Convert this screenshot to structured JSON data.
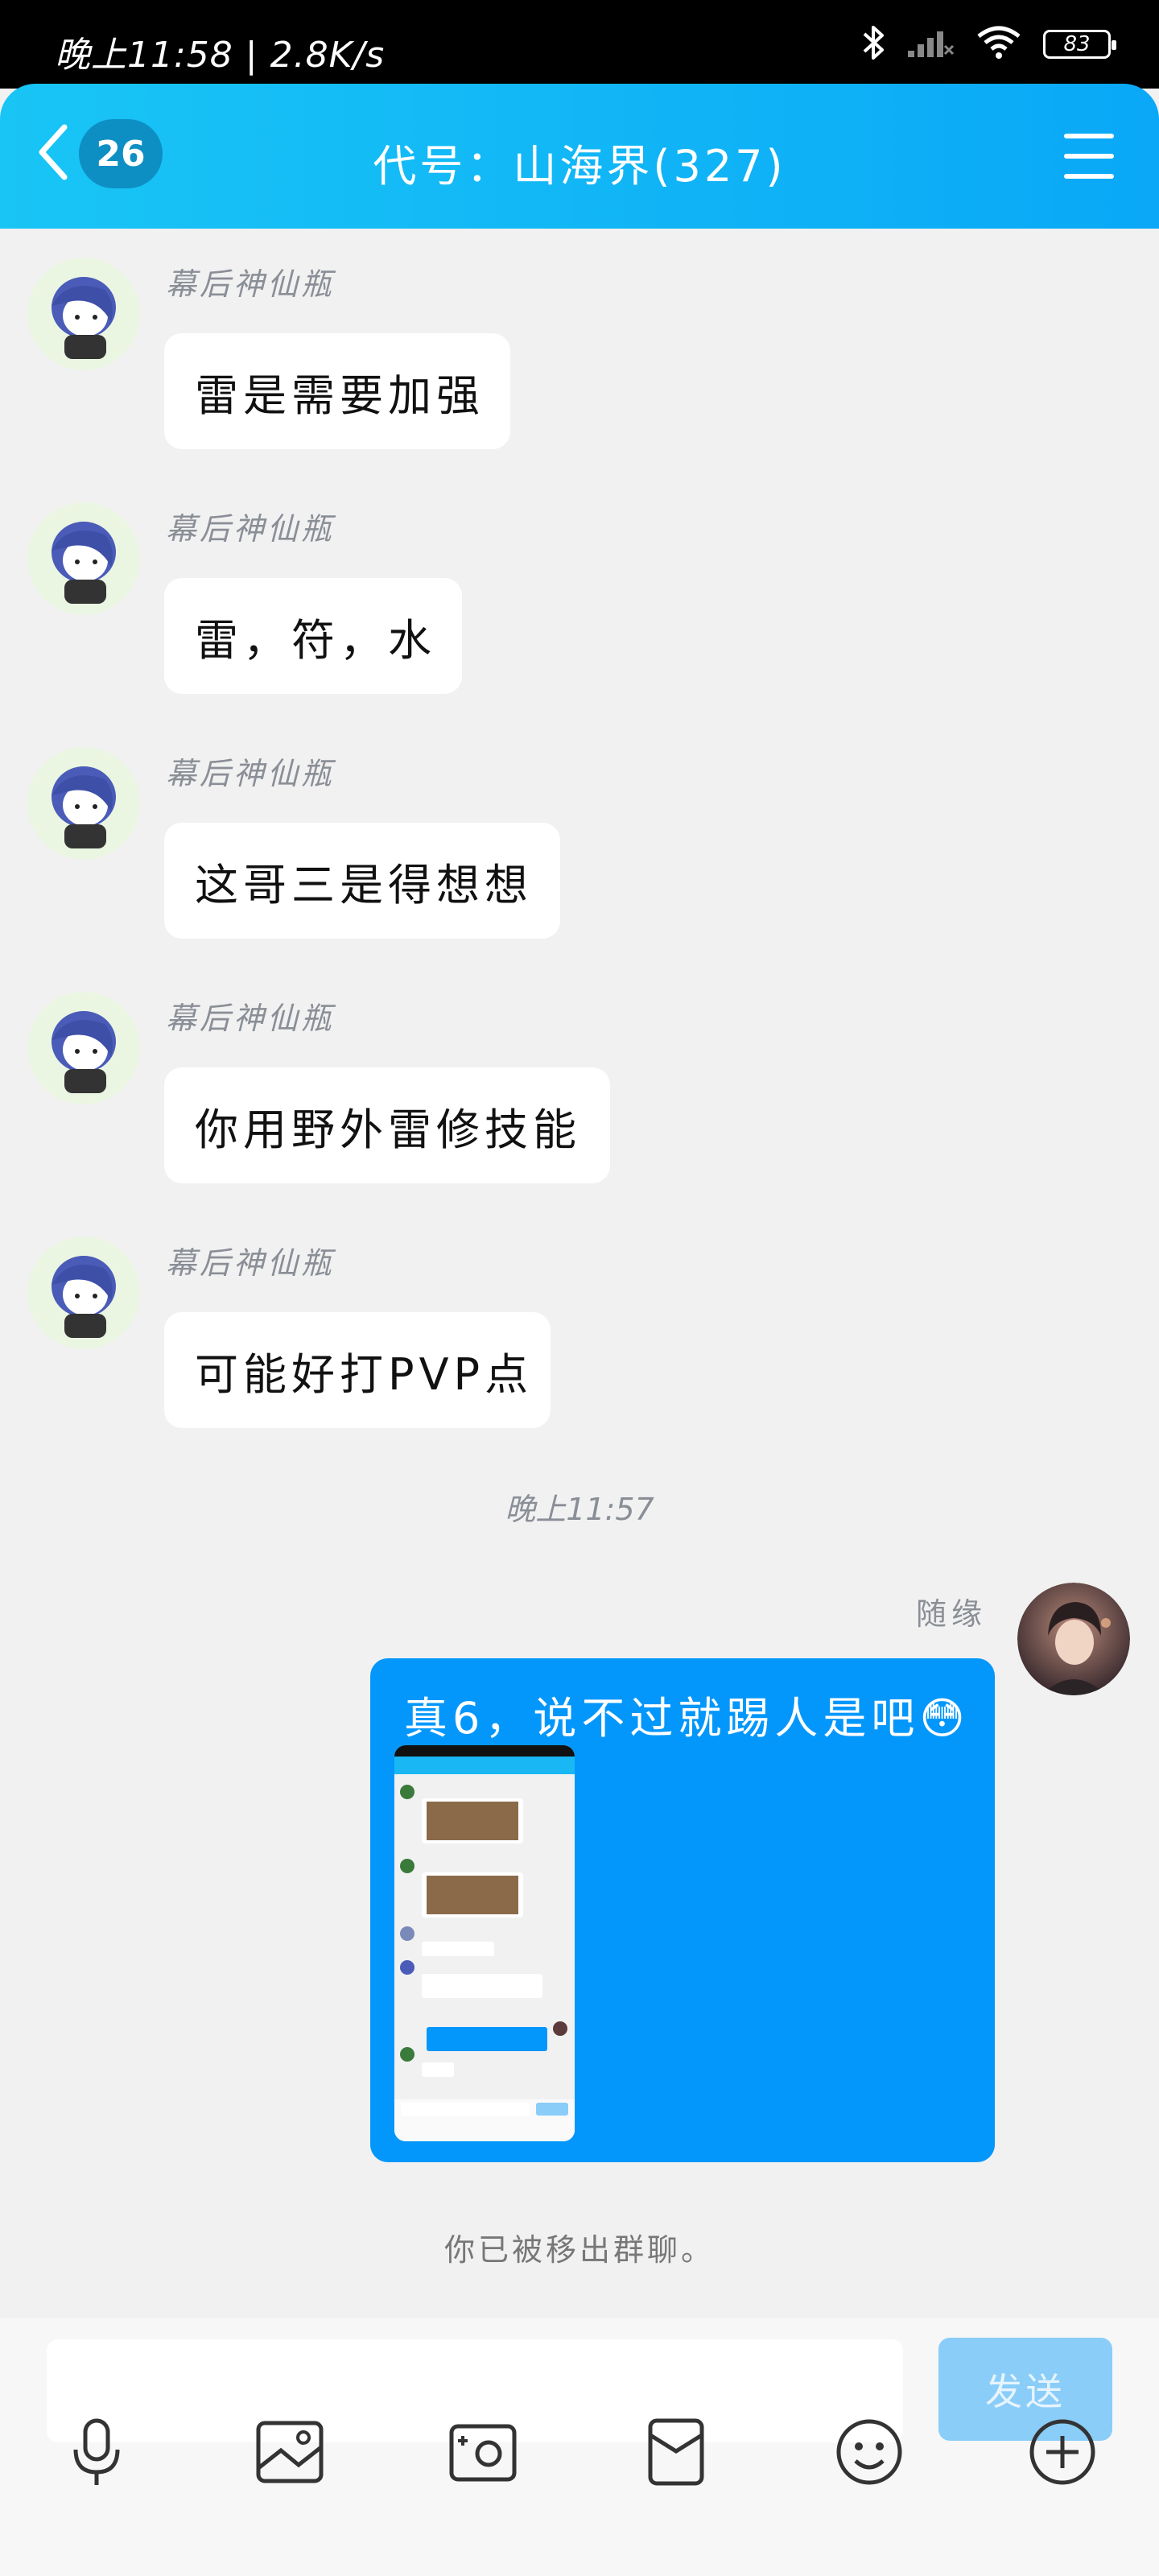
{
  "status_bar": {
    "time_speed": "晚上11:58 | 2.8K/s",
    "battery": "83"
  },
  "header": {
    "unread_count": "26",
    "title": "代号：山海界(327)"
  },
  "messages": [
    {
      "sender": "幕后神仙瓶",
      "text": "雷是需要加强"
    },
    {
      "sender": "幕后神仙瓶",
      "text": "雷，符，水"
    },
    {
      "sender": "幕后神仙瓶",
      "text": "这哥三是得想想"
    },
    {
      "sender": "幕后神仙瓶",
      "text": "你用野外雷修技能"
    },
    {
      "sender": "幕后神仙瓶",
      "text": "可能好打PVP点"
    }
  ],
  "timestamp": "晚上11:57",
  "my_message": {
    "sender": "随缘",
    "text": "真6，说不过就踢人是吧😳"
  },
  "system_note": "你已被移出群聊。",
  "input": {
    "value": "",
    "placeholder": "",
    "send_label": "发送"
  },
  "toolbar_icons": [
    "microphone-icon",
    "image-icon",
    "camera-icon",
    "red-packet-icon",
    "emoji-icon",
    "plus-icon"
  ],
  "colors": {
    "header_start": "#19c5f5",
    "header_end": "#0aa8f7",
    "my_bubble": "#0497fb",
    "send_disabled": "#8acdf8"
  }
}
